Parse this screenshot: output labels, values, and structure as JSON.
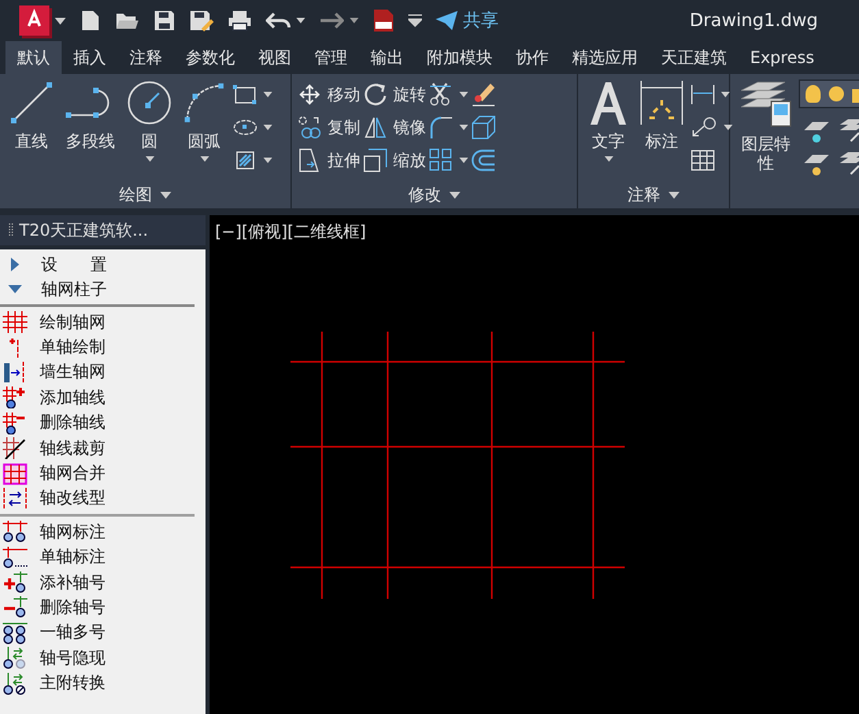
{
  "title_bar": {
    "share_label": "共享",
    "title": "Drawing1.dwg"
  },
  "tabs": [
    {
      "label": "默认",
      "selected": true
    },
    {
      "label": "插入",
      "selected": false
    },
    {
      "label": "注释",
      "selected": false
    },
    {
      "label": "参数化",
      "selected": false
    },
    {
      "label": "视图",
      "selected": false
    },
    {
      "label": "管理",
      "selected": false
    },
    {
      "label": "输出",
      "selected": false
    },
    {
      "label": "附加模块",
      "selected": false
    },
    {
      "label": "协作",
      "selected": false
    },
    {
      "label": "精选应用",
      "selected": false
    },
    {
      "label": "天正建筑",
      "selected": false
    },
    {
      "label": "Express",
      "selected": false
    }
  ],
  "ribbon": {
    "panels": [
      {
        "title": "绘图",
        "large": [
          {
            "label": "直线",
            "dropdown": false
          },
          {
            "label": "多段线",
            "dropdown": false
          },
          {
            "label": "圆",
            "dropdown": true
          },
          {
            "label": "圆弧",
            "dropdown": true
          }
        ],
        "columns": [
          [
            {
              "dropdown": true
            },
            {
              "dropdown": true
            },
            {
              "dropdown": true
            }
          ]
        ]
      },
      {
        "title": "修改",
        "columns": [
          [
            {
              "label": "移动",
              "dropdown": false
            },
            {
              "label": "复制",
              "dropdown": false
            },
            {
              "label": "拉伸",
              "dropdown": false
            }
          ],
          [
            {
              "label": "旋转",
              "dropdown": false
            },
            {
              "label": "镜像",
              "dropdown": false
            },
            {
              "label": "缩放",
              "dropdown": false
            }
          ],
          [
            {
              "dropdown": true
            },
            {
              "dropdown": true
            },
            {
              "dropdown": true
            }
          ],
          [
            {
              "dropdown": false
            },
            {
              "dropdown": false
            },
            {
              "dropdown": false
            }
          ]
        ]
      },
      {
        "title": "注释",
        "large": [
          {
            "label": "文字",
            "dropdown": true
          },
          {
            "label": "标注",
            "dropdown": false
          }
        ],
        "columns": [
          [
            {
              "dropdown": true
            },
            {
              "dropdown": true
            },
            {
              "dropdown": false
            }
          ]
        ]
      },
      {
        "large": [
          {
            "label": "图层特性",
            "dropdown": false
          }
        ]
      }
    ]
  },
  "palette": {
    "title": "T20天正建筑软...",
    "sections": [
      {
        "label": "设　　置",
        "expanded": false
      },
      {
        "label": "轴网柱子",
        "expanded": true,
        "groups": [
          [
            "绘制轴网",
            "单轴绘制",
            "墙生轴网",
            "添加轴线",
            "删除轴线",
            "轴线裁剪",
            "轴网合并",
            "轴改线型"
          ],
          [
            "轴网标注",
            "单轴标注",
            "添补轴号",
            "删除轴号",
            "一轴多号",
            "轴号隐现",
            "主附转换"
          ]
        ]
      }
    ]
  },
  "viewport": {
    "label": "[−][俯视][二维线框]"
  }
}
